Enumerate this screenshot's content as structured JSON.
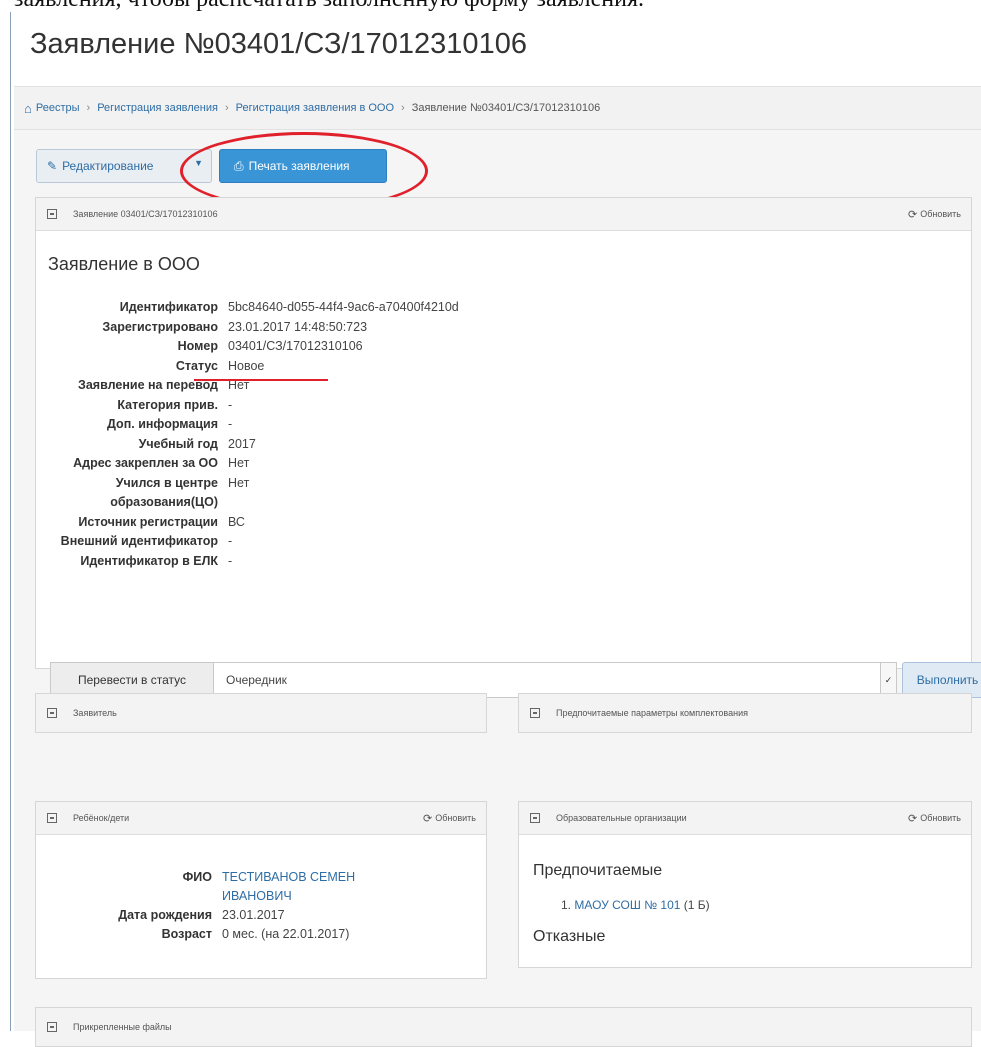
{
  "intro_text": "заявления, чтобы распечатать заполненную форму заявления.",
  "page_title": "Заявление №03401/СЗ/17012310106",
  "breadcrumb": {
    "items": [
      "Реестры",
      "Регистрация заявления",
      "Регистрация заявления в ООО",
      "Заявление №03401/СЗ/17012310106"
    ]
  },
  "toolbar": {
    "edit_label": "Редактирование",
    "print_label": "Печать заявления"
  },
  "main_panel": {
    "header": "Заявление 03401/СЗ/17012310106",
    "refresh": "Обновить",
    "section_title": "Заявление в ООО",
    "rows": [
      {
        "label": "Идентификатор",
        "value": "5bc84640-d055-44f4-9ac6-a70400f4210d"
      },
      {
        "label": "Зарегистрировано",
        "value": "23.01.2017 14:48:50:723"
      },
      {
        "label": "Номер",
        "value": "03401/СЗ/17012310106"
      },
      {
        "label": "Статус",
        "value": "Новое"
      },
      {
        "label": "Заявление на перевод",
        "value": "Нет"
      },
      {
        "label": "Категория прив.",
        "value": "-"
      },
      {
        "label": "Доп. информация",
        "value": "-"
      },
      {
        "label": "Учебный год",
        "value": "2017"
      },
      {
        "label": "Адрес закреплен за ОО",
        "value": "Нет"
      },
      {
        "label": "Учился в центре образования(ЦО)",
        "value": "Нет"
      },
      {
        "label": "Источник регистрации",
        "value": "ВС"
      },
      {
        "label": "Внешний идентификатор",
        "value": "-"
      },
      {
        "label": "Идентификатор в ЕЛК",
        "value": "-"
      }
    ],
    "status_form": {
      "label": "Перевести в статус",
      "selected": "Очередник",
      "button": "Выполнить"
    }
  },
  "applicant_panel": {
    "header": "Заявитель"
  },
  "params_panel": {
    "header": "Предпочитаемые параметры комплектования"
  },
  "child_panel": {
    "header": "Ребёнок/дети",
    "refresh": "Обновить",
    "rows": [
      {
        "label": "ФИО",
        "value": "ТЕСТИВАНОВ СЕМЕН ИВАНОВИЧ"
      },
      {
        "label": "Дата рождения",
        "value": "23.01.2017"
      },
      {
        "label": "Возраст",
        "value": "0 мес. (на 22.01.2017)"
      }
    ]
  },
  "orgs_panel": {
    "header": "Образовательные организации",
    "refresh": "Обновить",
    "preferred_title": "Предпочитаемые",
    "preferred_item_num": "1.",
    "preferred_item_name": "МАОУ СОШ № 101",
    "preferred_item_extra": "(1 Б)",
    "rejected_title": "Отказные"
  },
  "files_panel": {
    "header": "Прикрепленные файлы"
  },
  "colors": {
    "accent": "#3a95d6",
    "link": "#2e6da4",
    "annotation": "#e0202a"
  }
}
